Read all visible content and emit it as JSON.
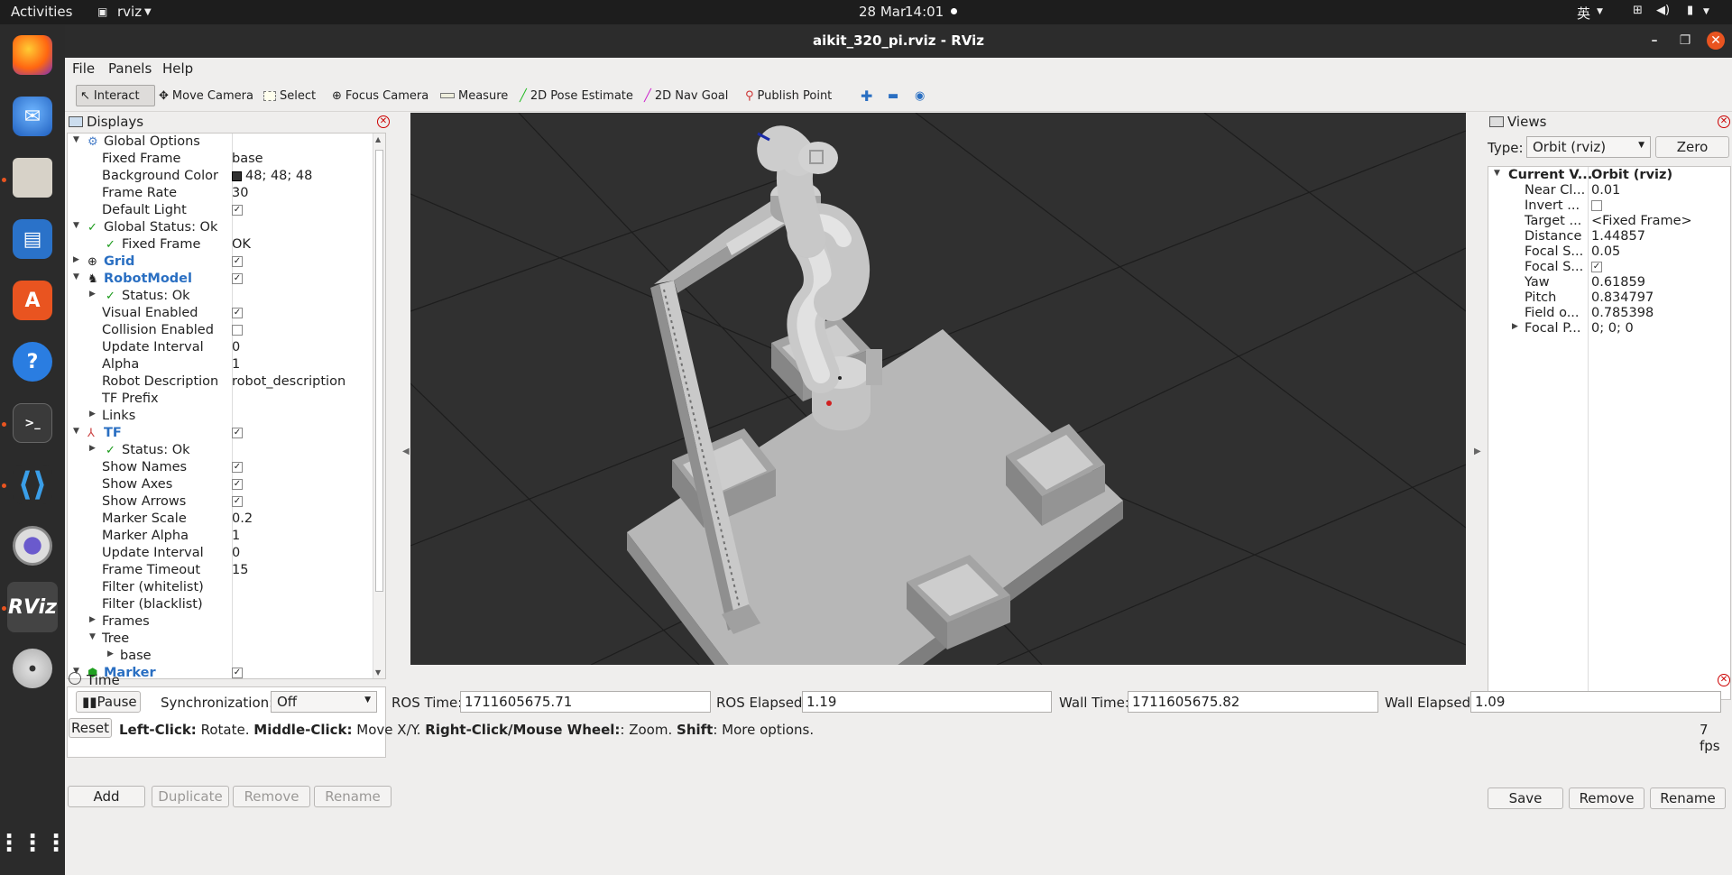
{
  "topbar": {
    "activities": "Activities",
    "app_name": "rviz",
    "date": "28 Mar",
    "time": "14:01",
    "input_method": "英"
  },
  "window": {
    "title": "aikit_320_pi.rviz - RViz"
  },
  "menu": [
    "File",
    "Panels",
    "Help"
  ],
  "toolbar": {
    "interact": "Interact",
    "move_camera": "Move Camera",
    "select": "Select",
    "focus_camera": "Focus Camera",
    "measure": "Measure",
    "pose_estimate": "2D Pose Estimate",
    "nav_goal": "2D Nav Goal",
    "publish_point": "Publish Point"
  },
  "displays": {
    "title": "Displays",
    "rows": [
      {
        "label": "Global Options",
        "value": ""
      },
      {
        "label": "Fixed Frame",
        "value": "base"
      },
      {
        "label": "Background Color",
        "value": "48; 48; 48"
      },
      {
        "label": "Frame Rate",
        "value": "30"
      },
      {
        "label": "Default Light",
        "value": ""
      },
      {
        "label": "Global Status: Ok",
        "value": ""
      },
      {
        "label": "Fixed Frame",
        "value": "OK"
      },
      {
        "label": "Grid",
        "value": ""
      },
      {
        "label": "RobotModel",
        "value": ""
      },
      {
        "label": "Status: Ok",
        "value": ""
      },
      {
        "label": "Visual Enabled",
        "value": ""
      },
      {
        "label": "Collision Enabled",
        "value": ""
      },
      {
        "label": "Update Interval",
        "value": "0"
      },
      {
        "label": "Alpha",
        "value": "1"
      },
      {
        "label": "Robot Description",
        "value": "robot_description"
      },
      {
        "label": "TF Prefix",
        "value": ""
      },
      {
        "label": "Links",
        "value": ""
      },
      {
        "label": "TF",
        "value": ""
      },
      {
        "label": "Status: Ok",
        "value": ""
      },
      {
        "label": "Show Names",
        "value": ""
      },
      {
        "label": "Show Axes",
        "value": ""
      },
      {
        "label": "Show Arrows",
        "value": ""
      },
      {
        "label": "Marker Scale",
        "value": "0.2"
      },
      {
        "label": "Marker Alpha",
        "value": "1"
      },
      {
        "label": "Update Interval",
        "value": "0"
      },
      {
        "label": "Frame Timeout",
        "value": "15"
      },
      {
        "label": "Filter (whitelist)",
        "value": ""
      },
      {
        "label": "Filter (blacklist)",
        "value": ""
      },
      {
        "label": "Frames",
        "value": ""
      },
      {
        "label": "Tree",
        "value": ""
      },
      {
        "label": "base",
        "value": ""
      },
      {
        "label": "Marker",
        "value": ""
      }
    ],
    "buttons": {
      "add": "Add",
      "duplicate": "Duplicate",
      "remove": "Remove",
      "rename": "Rename"
    },
    "background_color_hex": "#303030"
  },
  "views": {
    "title": "Views",
    "type_label": "Type:",
    "type_value": "Orbit (rviz)",
    "zero": "Zero",
    "rows": [
      {
        "label": "Current V...",
        "value": "Orbit (rviz)"
      },
      {
        "label": "Near Cl...",
        "value": "0.01"
      },
      {
        "label": "Invert ...",
        "value": ""
      },
      {
        "label": "Target ...",
        "value": "<Fixed Frame>"
      },
      {
        "label": "Distance",
        "value": "1.44857"
      },
      {
        "label": "Focal S...",
        "value": "0.05"
      },
      {
        "label": "Focal S...",
        "value": ""
      },
      {
        "label": "Yaw",
        "value": "0.61859"
      },
      {
        "label": "Pitch",
        "value": "0.834797"
      },
      {
        "label": "Field o...",
        "value": "0.785398"
      },
      {
        "label": "Focal P...",
        "value": "0; 0; 0"
      }
    ],
    "buttons": {
      "save": "Save",
      "remove": "Remove",
      "rename": "Rename"
    }
  },
  "time": {
    "title": "Time",
    "pause": "Pause",
    "sync_label": "Synchronization:",
    "sync_value": "Off",
    "ros_time_label": "ROS Time:",
    "ros_time": "1711605675.71",
    "ros_elapsed_label": "ROS Elapsed:",
    "ros_elapsed": "1.19",
    "wall_time_label": "Wall Time:",
    "wall_time": "1711605675.82",
    "wall_elapsed_label": "Wall Elapsed:",
    "wall_elapsed": "1.09"
  },
  "status": {
    "reset": "Reset",
    "left_click": "Left-Click:",
    "left_click_action": "Rotate.",
    "middle_click": "Middle-Click:",
    "middle_click_action": "Move X/Y.",
    "right_click": "Right-Click/Mouse Wheel:",
    "right_click_action": ": Zoom.",
    "shift": "Shift",
    "shift_action": ": More options.",
    "fps": "7 fps"
  }
}
